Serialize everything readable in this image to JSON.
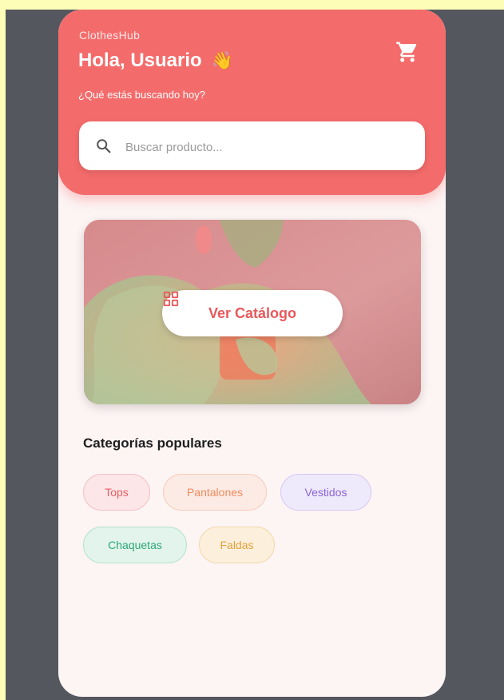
{
  "app": {
    "brand": "ClothesHub",
    "greeting": "Hola, Usuario",
    "subtitle": "¿Qué estás buscando hoy?"
  },
  "search": {
    "placeholder": "Buscar producto..."
  },
  "banner": {
    "button_label": "Ver Catálogo"
  },
  "categories": {
    "title": "Categorías populares",
    "items": [
      {
        "label": "Tops",
        "color": "#e85d63",
        "bg": "#fce6e7",
        "border": "#f4c2c5"
      },
      {
        "label": "Pantalones",
        "color": "#ef8a5e",
        "bg": "#fcebe4",
        "border": "#f6cdb9"
      },
      {
        "label": "Vestidos",
        "color": "#8a63d6",
        "bg": "#efeafb",
        "border": "#d6c9f3"
      },
      {
        "label": "Chaquetas",
        "color": "#2da877",
        "bg": "#e2f4ec",
        "border": "#b6e2cf"
      },
      {
        "label": "Faldas",
        "color": "#e3a13a",
        "bg": "#fcf0dd",
        "border": "#f3d8a9"
      }
    ]
  },
  "colors": {
    "accent": "#f46b6b",
    "background": "#fdf4f4"
  },
  "icons": [
    "cart-icon",
    "search-icon",
    "waving-hand-icon",
    "grid-icon"
  ]
}
